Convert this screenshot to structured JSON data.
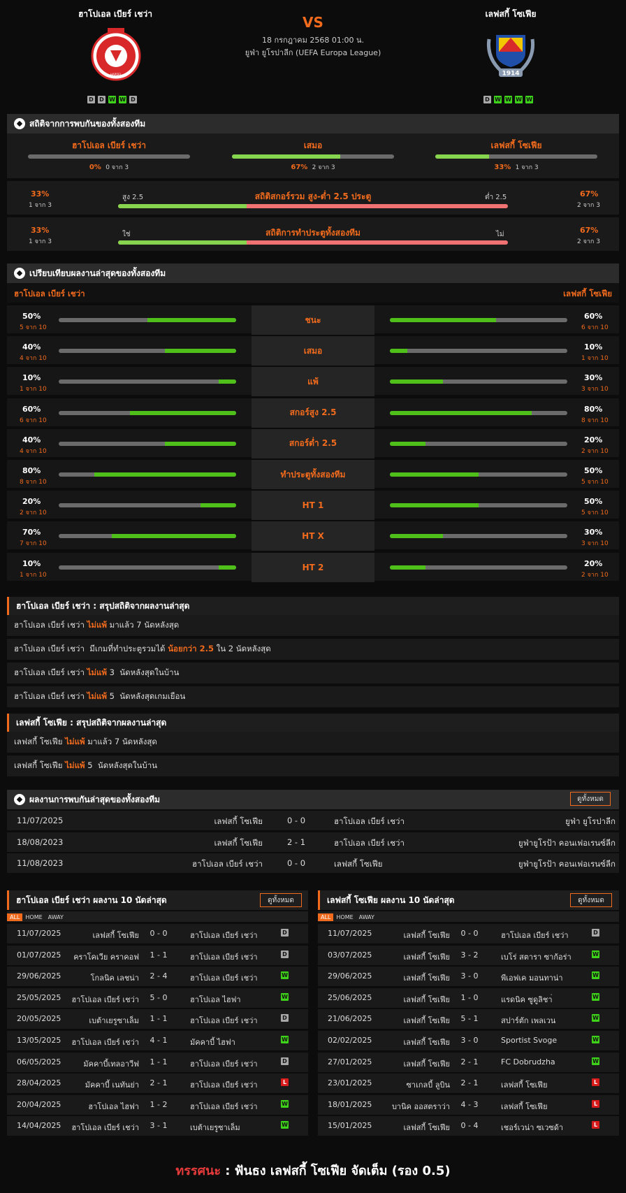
{
  "header": {
    "home_name": "ฮาโปเอล เบียร์ เชว่า",
    "away_name": "เลฟสกี้ โซเฟีย",
    "vs": "VS",
    "datetime": "18 กรกฎาคม 2568 01:00 น.",
    "competition": "ยูฟ่า ยูโรปาลีก (UEFA Europa League)",
    "home_form": [
      "D",
      "D",
      "W",
      "W",
      "D"
    ],
    "away_form": [
      "D",
      "W",
      "W",
      "W",
      "W"
    ],
    "home_crest_text": "HAPOEL BEER SHEVA",
    "away_crest_year": "1914"
  },
  "h2h_stats": {
    "title": "สถิติจากการพบกันของทั้งสองทีม",
    "cols": [
      {
        "name": "ฮาโปเอล เบียร์ เชว่า",
        "pct": "0%",
        "sub": "0 จาก 3",
        "fill": 0
      },
      {
        "name": "เสมอ",
        "pct": "67%",
        "sub": "2 จาก 3",
        "fill": 0.67
      },
      {
        "name": "เลฟสกี้ โซเฟีย",
        "pct": "33%",
        "sub": "1 จาก 3",
        "fill": 0.33
      }
    ],
    "ou": {
      "title": "สถิติสกอร์รวม สูง-ต่ำ 2.5 ประตู",
      "left_label": "สูง 2.5",
      "right_label": "ต่ำ 2.5",
      "left_pct": "33%",
      "left_sub": "1 จาก 3",
      "right_pct": "67%",
      "right_sub": "2 จาก 3",
      "left_fill": 0.33
    },
    "btts": {
      "title": "สถิติการทำประตูทั้งสองทีม",
      "left_label": "ใช่",
      "right_label": "ไม่",
      "left_pct": "33%",
      "left_sub": "1 จาก 3",
      "right_pct": "67%",
      "right_sub": "2 จาก 3",
      "left_fill": 0.33
    }
  },
  "compare": {
    "title": "เปรียบเทียบผลงานล่าสุดของทั้งสองทีม",
    "home": "ฮาโปเอล เบียร์ เชว่า",
    "away": "เลฟสกี้ โซเฟีย",
    "rows": [
      {
        "label": "ชนะ",
        "hp": "50%",
        "hs": "5 จาก 10",
        "hf": 0.5,
        "ap": "60%",
        "as": "6 จาก 10",
        "af": 0.6
      },
      {
        "label": "เสมอ",
        "hp": "40%",
        "hs": "4 จาก 10",
        "hf": 0.4,
        "ap": "10%",
        "as": "1 จาก 10",
        "af": 0.1
      },
      {
        "label": "แพ้",
        "hp": "10%",
        "hs": "1 จาก 10",
        "hf": 0.1,
        "ap": "30%",
        "as": "3 จาก 10",
        "af": 0.3
      },
      {
        "label": "สกอร์สูง 2.5",
        "hp": "60%",
        "hs": "6 จาก 10",
        "hf": 0.6,
        "ap": "80%",
        "as": "8 จาก 10",
        "af": 0.8
      },
      {
        "label": "สกอร์ต่ำ 2.5",
        "hp": "40%",
        "hs": "4 จาก 10",
        "hf": 0.4,
        "ap": "20%",
        "as": "2 จาก 10",
        "af": 0.2
      },
      {
        "label": "ทำประตูทั้งสองทีม",
        "hp": "80%",
        "hs": "8 จาก 10",
        "hf": 0.8,
        "ap": "50%",
        "as": "5 จาก 10",
        "af": 0.5
      },
      {
        "label": "HT 1",
        "hp": "20%",
        "hs": "2 จาก 10",
        "hf": 0.2,
        "ap": "50%",
        "as": "5 จาก 10",
        "af": 0.5
      },
      {
        "label": "HT X",
        "hp": "70%",
        "hs": "7 จาก 10",
        "hf": 0.7,
        "ap": "30%",
        "as": "3 จาก 10",
        "af": 0.3
      },
      {
        "label": "HT 2",
        "hp": "10%",
        "hs": "1 จาก 10",
        "hf": 0.1,
        "ap": "20%",
        "as": "2 จาก 10",
        "af": 0.2
      }
    ]
  },
  "home_summary": {
    "title": "ฮาโปเอล เบียร์ เชว่า : สรุปสถิติจากผลงานล่าสุด",
    "rows": [
      {
        "a": "ฮาโปเอล เบียร์ เชว่า ",
        "h": "ไม่แพ้",
        "b": " มาแล้ว 7 นัดหลังสุด"
      },
      {
        "a": "ฮาโปเอล เบียร์ เชว่า  มีเกมที่ทำประตูรวมได้ ",
        "h": "น้อยกว่า 2.5",
        "b": " ใน 2 นัดหลังสุด"
      },
      {
        "a": "ฮาโปเอล เบียร์ เชว่า ",
        "h": "ไม่แพ้",
        "b": " 3  นัดหลังสุดในบ้าน"
      },
      {
        "a": "ฮาโปเอล เบียร์ เชว่า ",
        "h": "ไม่แพ้",
        "b": " 5  นัดหลังสุดเกมเยือน"
      }
    ]
  },
  "away_summary": {
    "title": "เลฟสกี้ โซเฟีย : สรุปสถิติจากผลงานล่าสุด",
    "rows": [
      {
        "a": "เลฟสกี้ โซเฟีย ",
        "h": "ไม่แพ้",
        "b": " มาแล้ว 7 นัดหลังสุด"
      },
      {
        "a": "เลฟสกี้ โซเฟีย ",
        "h": "ไม่แพ้",
        "b": " 5  นัดหลังสุดในบ้าน"
      }
    ]
  },
  "h2h": {
    "title": "ผลงานการพบกันล่าสุดของทั้งสองทีม",
    "view_all": "ดูทั้งหมด",
    "rows": [
      {
        "date": "11/07/2025",
        "home": "เลฟสกี้ โซเฟีย",
        "score": "0 - 0",
        "away": "ฮาโปเอล เบียร์ เชว่า",
        "comp": "ยูฟ่า ยูโรปาลีก"
      },
      {
        "date": "18/08/2023",
        "home": "เลฟสกี้ โซเฟีย",
        "score": "2 - 1",
        "away": "ฮาโปเอล เบียร์ เชว่า",
        "comp": "ยูฟ่ายูโรป้า คอนเฟอเรนซ์ลีก"
      },
      {
        "date": "11/08/2023",
        "home": "ฮาโปเอล เบียร์ เชว่า",
        "score": "0 - 0",
        "away": "เลฟสกี้ โซเฟีย",
        "comp": "ยูฟ่ายูโรป้า คอนเฟอเรนซ์ลีก"
      }
    ]
  },
  "home_last10": {
    "title": "ฮาโปเอล เบียร์ เชว่า ผลงาน 10 นัดล่าสุด",
    "view_all": "ดูทั้งหมด",
    "tabs": [
      "ALL",
      "HOME",
      "AWAY"
    ],
    "rows": [
      {
        "date": "11/07/2025",
        "home": "เลฟสกี้ โซเฟีย",
        "score": "0 - 0",
        "away": "ฮาโปเอล เบียร์ เชว่า",
        "r": "D"
      },
      {
        "date": "01/07/2025",
        "home": "คราโคเวีย คราคอฟ",
        "score": "1 - 1",
        "away": "ฮาโปเอล เบียร์ เชว่า",
        "r": "D"
      },
      {
        "date": "29/06/2025",
        "home": "โกลนิค เลชน่า",
        "score": "2 - 4",
        "away": "ฮาโปเอล เบียร์ เชว่า",
        "r": "W"
      },
      {
        "date": "25/05/2025",
        "home": "ฮาโปเอล เบียร์ เชว่า",
        "score": "5 - 0",
        "away": "ฮาโปเอล ไฮฟา",
        "r": "W"
      },
      {
        "date": "20/05/2025",
        "home": "เบต้าเยรูซาเล็ม",
        "score": "1 - 1",
        "away": "ฮาโปเอล เบียร์ เชว่า",
        "r": "D"
      },
      {
        "date": "13/05/2025",
        "home": "ฮาโปเอล เบียร์ เชว่า",
        "score": "4 - 1",
        "away": "มัคคาบี้ ไฮฟา",
        "r": "W"
      },
      {
        "date": "06/05/2025",
        "home": "มัคคาบี้เทลอาวีฟ",
        "score": "1 - 1",
        "away": "ฮาโปเอล เบียร์ เชว่า",
        "r": "D"
      },
      {
        "date": "28/04/2025",
        "home": "มัคคาบี้ เนทันย่า",
        "score": "2 - 1",
        "away": "ฮาโปเอล เบียร์ เชว่า",
        "r": "L"
      },
      {
        "date": "20/04/2025",
        "home": "ฮาโปเอล ไฮฟา",
        "score": "1 - 2",
        "away": "ฮาโปเอล เบียร์ เชว่า",
        "r": "W"
      },
      {
        "date": "14/04/2025",
        "home": "ฮาโปเอล เบียร์ เชว่า",
        "score": "3 - 1",
        "away": "เบต้าเยรูซาเล็ม",
        "r": "W"
      }
    ]
  },
  "away_last10": {
    "title": "เลฟสกี้ โซเฟีย ผลงาน 10 นัดล่าสุด",
    "view_all": "ดูทั้งหมด",
    "tabs": [
      "ALL",
      "HOME",
      "AWAY"
    ],
    "rows": [
      {
        "date": "11/07/2025",
        "home": "เลฟสกี้ โซเฟีย",
        "score": "0 - 0",
        "away": "ฮาโปเอล เบียร์ เชว่า",
        "r": "D"
      },
      {
        "date": "03/07/2025",
        "home": "เลฟสกี้ โซเฟีย",
        "score": "3 - 2",
        "away": "เบโร่ สตารา ซาก้อร่า",
        "r": "W"
      },
      {
        "date": "29/06/2025",
        "home": "เลฟสกี้ โซเฟีย",
        "score": "3 - 0",
        "away": "พีเอฟเค มอนทาน่า",
        "r": "W"
      },
      {
        "date": "25/06/2025",
        "home": "เลฟสกี้ โซเฟีย",
        "score": "1 - 0",
        "away": "แรดนิค ซูดูลิชา่",
        "r": "W"
      },
      {
        "date": "21/06/2025",
        "home": "เลฟสกี้ โซเฟีย",
        "score": "5 - 1",
        "away": "สปาร์ตัก เพลเวน",
        "r": "W"
      },
      {
        "date": "02/02/2025",
        "home": "เลฟสกี้ โซเฟีย",
        "score": "3 - 0",
        "away": "Sportist Svoge",
        "r": "W"
      },
      {
        "date": "27/01/2025",
        "home": "เลฟสกี้ โซเฟีย",
        "score": "2 - 1",
        "away": "FC Dobrudzha",
        "r": "W"
      },
      {
        "date": "23/01/2025",
        "home": "ซาเกลบี้ ลูบิน",
        "score": "2 - 1",
        "away": "เลฟสกี้ โซเฟีย",
        "r": "L"
      },
      {
        "date": "18/01/2025",
        "home": "บานิค ออสตราว่า",
        "score": "4 - 3",
        "away": "เลฟสกี้ โซเฟีย",
        "r": "L"
      },
      {
        "date": "15/01/2025",
        "home": "เลฟสกี้ โซเฟีย",
        "score": "0 - 4",
        "away": "เชอร์เวน่า ซเวซด้า",
        "r": "L"
      }
    ]
  },
  "prediction": {
    "label": "ทรรศนะ",
    "colon": " : ",
    "text": "ฟันธง เลฟสกี้ โซเฟีย จัดเต็ม (รอง 0.5)"
  },
  "colors": {
    "accent": "#f26b1d",
    "bar_green": "#4fbf1a",
    "bar_gray": "#6b6b6b",
    "bar_red": "#f07272",
    "win": "#3fd21b",
    "draw": "#a8a8a8",
    "loss": "#d81b1b"
  }
}
